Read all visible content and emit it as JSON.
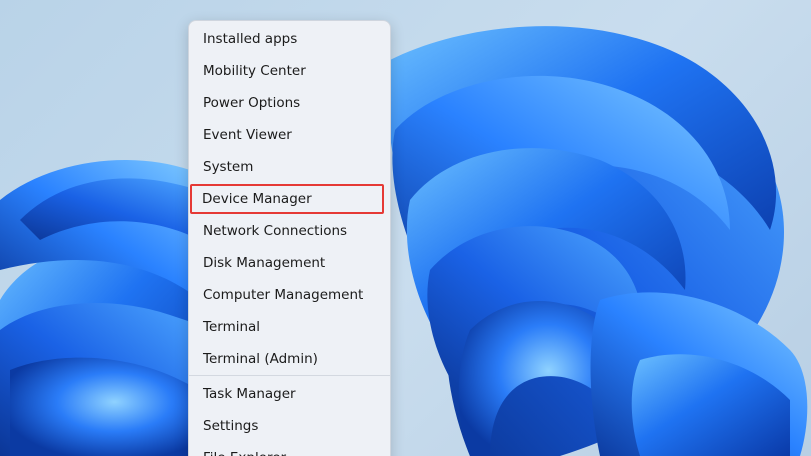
{
  "context_menu": {
    "items": [
      {
        "label": "Installed apps"
      },
      {
        "label": "Mobility Center"
      },
      {
        "label": "Power Options"
      },
      {
        "label": "Event Viewer"
      },
      {
        "label": "System"
      },
      {
        "label": "Device Manager",
        "highlighted": true
      },
      {
        "label": "Network Connections"
      },
      {
        "label": "Disk Management"
      },
      {
        "label": "Computer Management"
      },
      {
        "label": "Terminal"
      },
      {
        "label": "Terminal (Admin)"
      },
      {
        "label": "Task Manager"
      },
      {
        "label": "Settings"
      },
      {
        "label": "File Explorer"
      }
    ],
    "highlight_color": "#e53935"
  },
  "wallpaper": {
    "name": "windows-11-bloom",
    "colors": {
      "background": "#c3d8ec",
      "bloom_dark": "#0a3fb0",
      "bloom_mid": "#1e6ff0",
      "bloom_light": "#5fb2ff"
    }
  }
}
